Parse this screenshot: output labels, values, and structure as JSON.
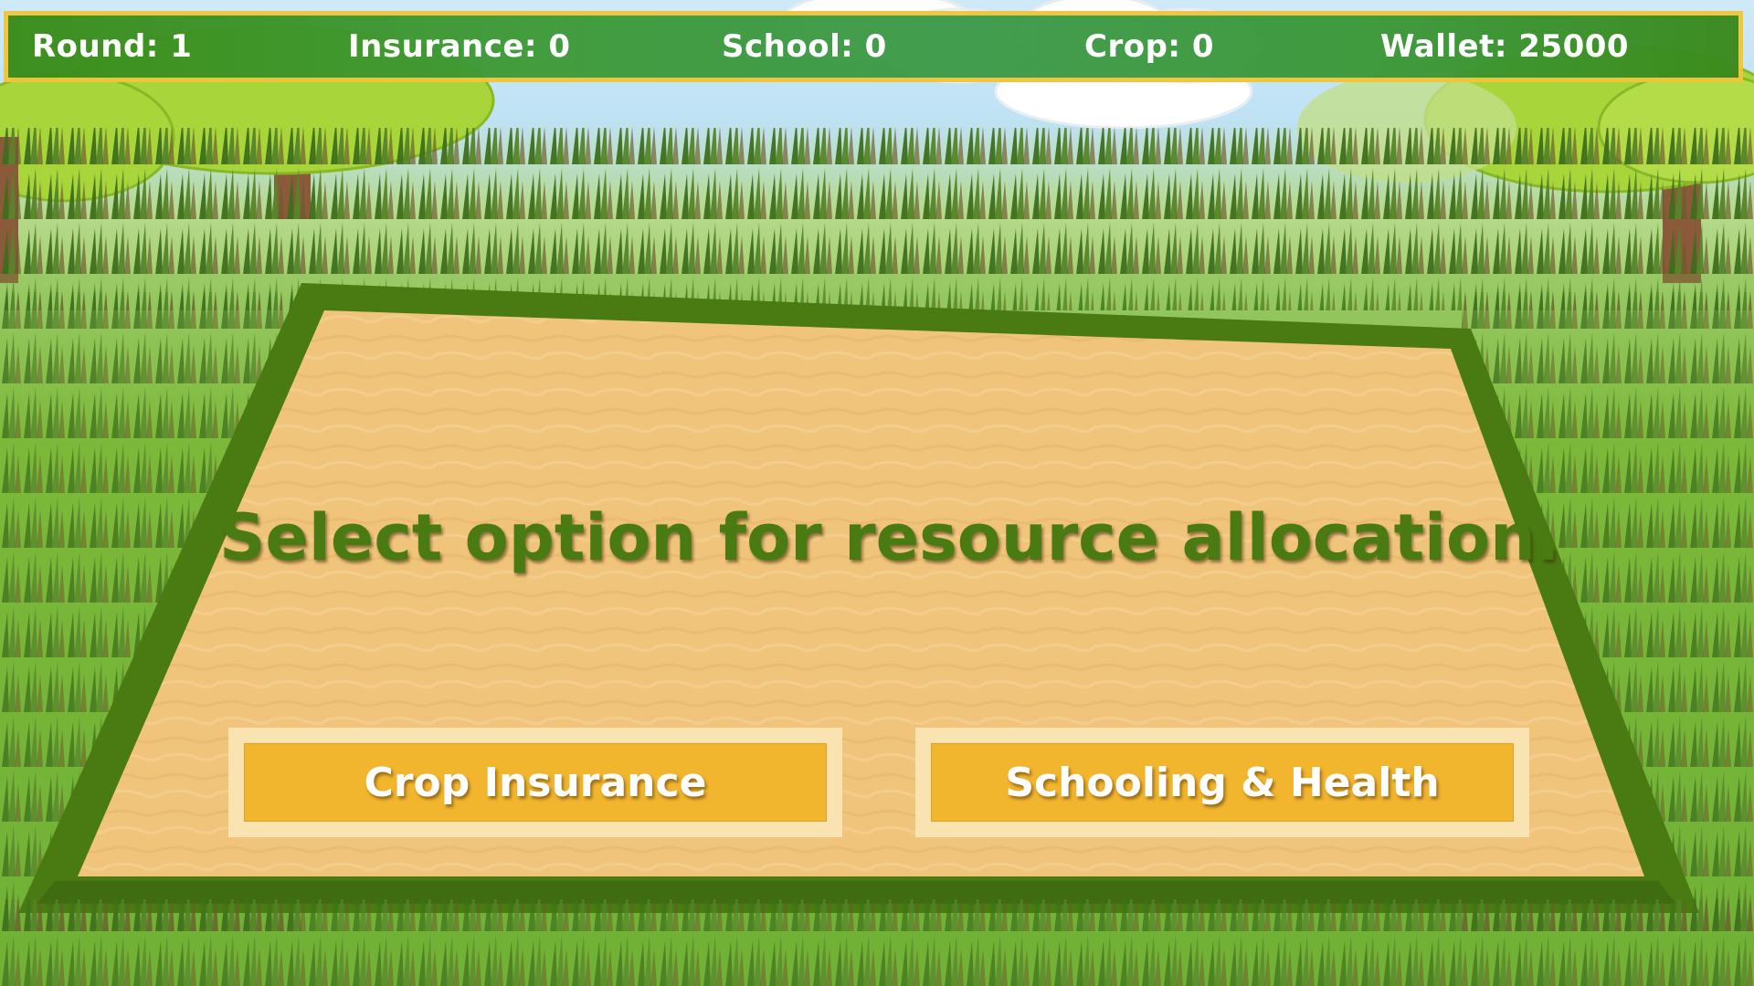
{
  "hud": {
    "round_label": "Round: 1",
    "insurance_label": "Insurance: 0",
    "school_label": "School: 0",
    "crop_label": "Crop: 0",
    "wallet_label": "Wallet: 25000"
  },
  "prompt": "Select option for resource allocation.",
  "buttons": {
    "crop_insurance": "Crop Insurance",
    "schooling_health": "Schooling & Health"
  },
  "colors": {
    "hud_bg": "#3c9a3c",
    "hud_border": "#f0c53a",
    "prompt_text": "#4a7a12",
    "button_fill": "#f2b52e",
    "button_border": "#f9e3b0",
    "field_border": "#4a7a12",
    "field_sand": "#f0c479"
  }
}
